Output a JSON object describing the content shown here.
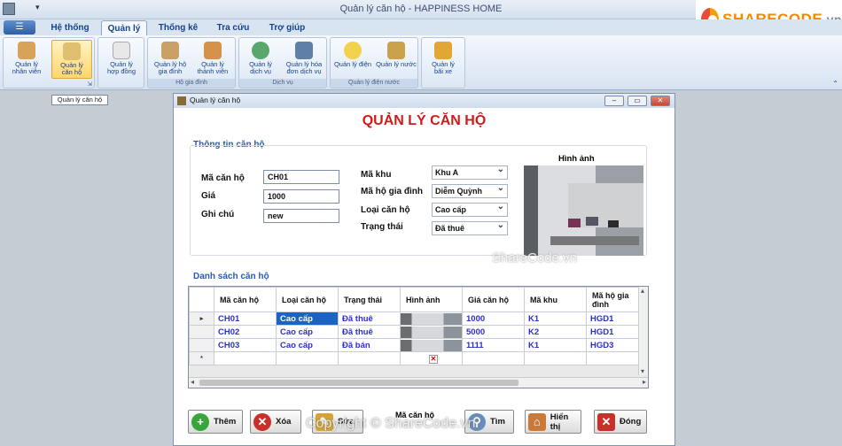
{
  "window": {
    "title": "Quản lý căn hộ - HAPPINESS HOME",
    "file_label": "☰"
  },
  "brand": {
    "name": "SHARECODE",
    "suffix": ".vn"
  },
  "menu": {
    "tabs": [
      "Hệ thống",
      "Quản lý",
      "Thống kê",
      "Tra cứu",
      "Trợ giúp"
    ],
    "active": "Quản lý"
  },
  "ribbon": {
    "groups": [
      {
        "label": "",
        "buttons": [
          {
            "label1": "Quản lý",
            "label2": "nhân viên"
          },
          {
            "label1": "Quản lý",
            "label2": "căn hộ"
          }
        ]
      },
      {
        "label": "",
        "buttons": [
          {
            "label1": "Quản lý",
            "label2": "hợp đồng"
          }
        ]
      },
      {
        "label": "Hộ gia đình",
        "buttons": [
          {
            "label1": "Quản lý hộ",
            "label2": "gia đình"
          },
          {
            "label1": "Quản lý",
            "label2": "thành viên"
          }
        ]
      },
      {
        "label": "Dịch vụ",
        "buttons": [
          {
            "label1": "Quản lý",
            "label2": "dịch vụ"
          },
          {
            "label1": "Quản lý hóa",
            "label2": "đơn dịch vụ"
          }
        ]
      },
      {
        "label": "Quản lý điện nước",
        "buttons": [
          {
            "label1": "Quản lý điện",
            "label2": ""
          },
          {
            "label1": "Quản lý nước",
            "label2": ""
          }
        ]
      },
      {
        "label": "",
        "buttons": [
          {
            "label1": "Quản lý",
            "label2": "bãi xe"
          }
        ]
      }
    ],
    "tooltip": "Quản lý căn hộ"
  },
  "child": {
    "title": "Quản lý căn hộ",
    "heading": "QUẢN LÝ CĂN HỘ",
    "info_title": "Thông tin căn hộ",
    "fields": {
      "ma_can_ho": {
        "label": "Mã căn hộ",
        "value": "CH01"
      },
      "gia": {
        "label": "Giá",
        "value": "1000"
      },
      "ghi_chu": {
        "label": "Ghi chú",
        "value": "new"
      },
      "ma_khu": {
        "label": "Mã khu",
        "value": "Khu A"
      },
      "ma_ho": {
        "label": "Mã hộ gia đình",
        "value": "Diễm Quỳnh"
      },
      "loai": {
        "label": "Loại căn hộ",
        "value": "Cao cấp"
      },
      "trang_thai": {
        "label": "Trạng thái",
        "value": "Đã thuê"
      }
    },
    "image_label": "Hình ảnh",
    "list_title": "Danh sách căn hộ",
    "columns": [
      "Mã căn hộ",
      "Loại căn hộ",
      "Trạng thái",
      "Hình ảnh",
      "Giá căn hộ",
      "Mã khu",
      "Mã hộ gia đình"
    ],
    "rows": [
      {
        "marker": "▸",
        "id": "CH01",
        "loai": "Cao cấp",
        "tt": "Đã thuê",
        "gia": "1000",
        "khu": "K1",
        "ho": "HGD1"
      },
      {
        "marker": "",
        "id": "CH02",
        "loai": "Cao cấp",
        "tt": "Đã thuê",
        "gia": "5000",
        "khu": "K2",
        "ho": "HGD1"
      },
      {
        "marker": "",
        "id": "CH03",
        "loai": "Cao cấp",
        "tt": "Đã bán",
        "gia": "1111",
        "khu": "K1",
        "ho": "HGD3"
      }
    ],
    "new_row_marker": "*",
    "buttons": {
      "them": "Thêm",
      "xoa": "Xóa",
      "sua": "Sửa",
      "tim": "Tìm",
      "hien_thi": "Hiển thị",
      "dong": "Đóng"
    },
    "bottom_label": "Mã căn hộ"
  },
  "watermarks": {
    "top": "ShareCode.vn",
    "bottom": "Copyright © ShareCode.vn"
  }
}
